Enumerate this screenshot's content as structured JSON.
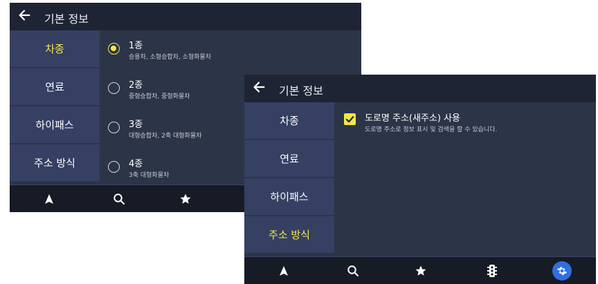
{
  "screen1": {
    "title": "기본 정보",
    "sidebar": [
      {
        "label": "차종",
        "active": true
      },
      {
        "label": "연료",
        "active": false
      },
      {
        "label": "하이패스",
        "active": false
      },
      {
        "label": "주소 방식",
        "active": false
      }
    ],
    "options": [
      {
        "title": "1종",
        "subtitle": "승용차, 소형승합차, 소형화물차",
        "selected": true
      },
      {
        "title": "2종",
        "subtitle": "중형승합차, 중형화물차",
        "selected": false
      },
      {
        "title": "3종",
        "subtitle": "대형승합차, 2축 대형화물차",
        "selected": false
      },
      {
        "title": "4종",
        "subtitle": "3축 대형화물차",
        "selected": false
      }
    ],
    "bottom_icons": [
      "navigation-arrow-icon",
      "search-icon",
      "star-icon"
    ]
  },
  "screen2": {
    "title": "기본 정보",
    "sidebar": [
      {
        "label": "차종",
        "active": false
      },
      {
        "label": "연료",
        "active": false
      },
      {
        "label": "하이패스",
        "active": false
      },
      {
        "label": "주소 방식",
        "active": true
      }
    ],
    "setting": {
      "title": "도로명 주소(새주소) 사용",
      "subtitle": "도로명 주소로 정보 표시 및 검색을 할 수 있습니다.",
      "checked": true
    },
    "bottom_icons": [
      "navigation-arrow-icon",
      "search-icon",
      "star-icon",
      "traffic-light-icon",
      "gear-icon"
    ]
  },
  "colors": {
    "header": "#1e2433",
    "sidebar": "#354063",
    "content": "#2c3447",
    "accent": "#f3e84a",
    "bottombar": "#161b26",
    "settings_button": "#2f6fe0"
  }
}
